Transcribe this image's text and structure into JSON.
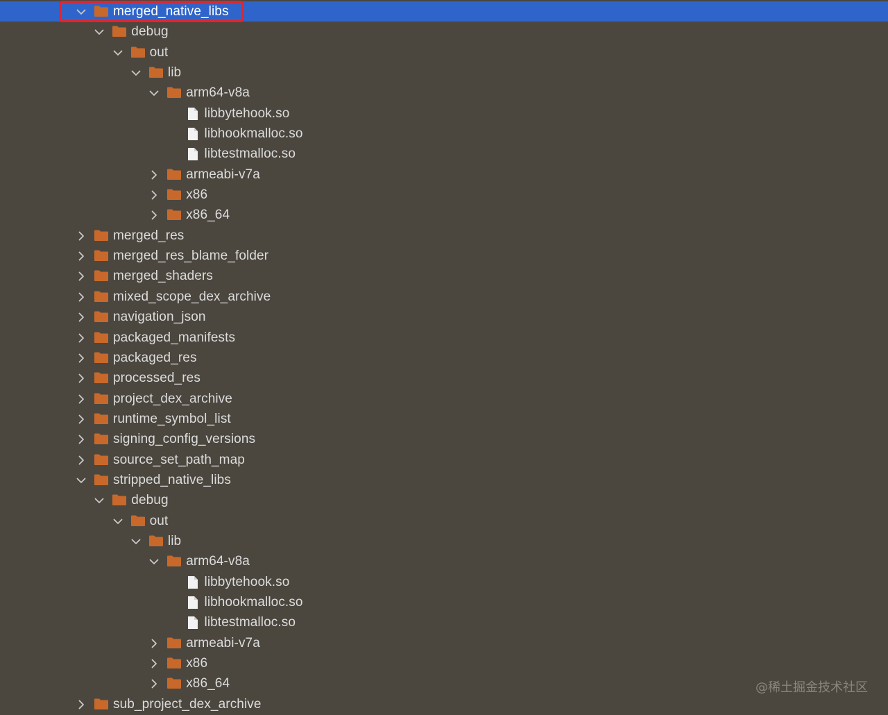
{
  "colors": {
    "background": "#4b473f",
    "selection": "#2f65ca",
    "folder": "#c8692b",
    "file": "#f2f2f2",
    "text": "#dcdcdc",
    "annotation": "#e3242b"
  },
  "watermark": "@稀土掘金技术社区",
  "tree": [
    {
      "label": "merged_native_libs",
      "depth": 0,
      "type": "folder",
      "expanded": true,
      "selected": true,
      "annotated": true
    },
    {
      "label": "debug",
      "depth": 1,
      "type": "folder",
      "expanded": true
    },
    {
      "label": "out",
      "depth": 2,
      "type": "folder",
      "expanded": true
    },
    {
      "label": "lib",
      "depth": 3,
      "type": "folder",
      "expanded": true
    },
    {
      "label": "arm64-v8a",
      "depth": 4,
      "type": "folder",
      "expanded": true
    },
    {
      "label": "libbytehook.so",
      "depth": 5,
      "type": "file"
    },
    {
      "label": "libhookmalloc.so",
      "depth": 5,
      "type": "file"
    },
    {
      "label": "libtestmalloc.so",
      "depth": 5,
      "type": "file"
    },
    {
      "label": "armeabi-v7a",
      "depth": 4,
      "type": "folder",
      "expanded": false
    },
    {
      "label": "x86",
      "depth": 4,
      "type": "folder",
      "expanded": false
    },
    {
      "label": "x86_64",
      "depth": 4,
      "type": "folder",
      "expanded": false
    },
    {
      "label": "merged_res",
      "depth": 0,
      "type": "folder",
      "expanded": false
    },
    {
      "label": "merged_res_blame_folder",
      "depth": 0,
      "type": "folder",
      "expanded": false
    },
    {
      "label": "merged_shaders",
      "depth": 0,
      "type": "folder",
      "expanded": false
    },
    {
      "label": "mixed_scope_dex_archive",
      "depth": 0,
      "type": "folder",
      "expanded": false
    },
    {
      "label": "navigation_json",
      "depth": 0,
      "type": "folder",
      "expanded": false
    },
    {
      "label": "packaged_manifests",
      "depth": 0,
      "type": "folder",
      "expanded": false
    },
    {
      "label": "packaged_res",
      "depth": 0,
      "type": "folder",
      "expanded": false
    },
    {
      "label": "processed_res",
      "depth": 0,
      "type": "folder",
      "expanded": false
    },
    {
      "label": "project_dex_archive",
      "depth": 0,
      "type": "folder",
      "expanded": false
    },
    {
      "label": "runtime_symbol_list",
      "depth": 0,
      "type": "folder",
      "expanded": false
    },
    {
      "label": "signing_config_versions",
      "depth": 0,
      "type": "folder",
      "expanded": false
    },
    {
      "label": "source_set_path_map",
      "depth": 0,
      "type": "folder",
      "expanded": false
    },
    {
      "label": "stripped_native_libs",
      "depth": 0,
      "type": "folder",
      "expanded": true
    },
    {
      "label": "debug",
      "depth": 1,
      "type": "folder",
      "expanded": true
    },
    {
      "label": "out",
      "depth": 2,
      "type": "folder",
      "expanded": true
    },
    {
      "label": "lib",
      "depth": 3,
      "type": "folder",
      "expanded": true
    },
    {
      "label": "arm64-v8a",
      "depth": 4,
      "type": "folder",
      "expanded": true
    },
    {
      "label": "libbytehook.so",
      "depth": 5,
      "type": "file"
    },
    {
      "label": "libhookmalloc.so",
      "depth": 5,
      "type": "file"
    },
    {
      "label": "libtestmalloc.so",
      "depth": 5,
      "type": "file"
    },
    {
      "label": "armeabi-v7a",
      "depth": 4,
      "type": "folder",
      "expanded": false
    },
    {
      "label": "x86",
      "depth": 4,
      "type": "folder",
      "expanded": false
    },
    {
      "label": "x86_64",
      "depth": 4,
      "type": "folder",
      "expanded": false
    },
    {
      "label": "sub_project_dex_archive",
      "depth": 0,
      "type": "folder",
      "expanded": false
    }
  ]
}
